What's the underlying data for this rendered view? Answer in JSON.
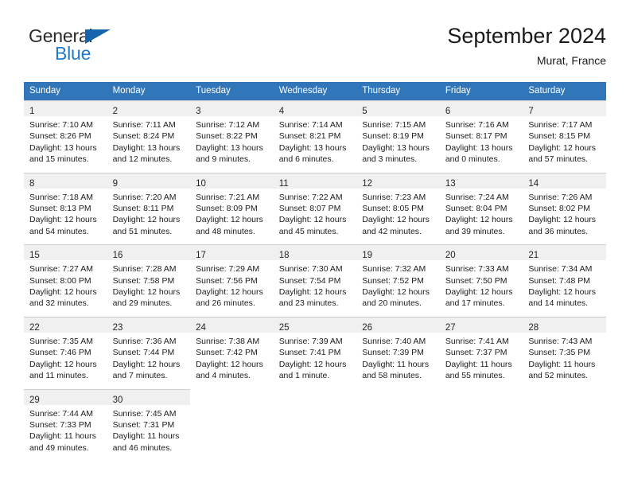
{
  "brand": {
    "line1": "General",
    "line2": "Blue",
    "triangle_color": "#1565ad",
    "line2_color": "#2079c6"
  },
  "header": {
    "title": "September 2024",
    "location": "Murat, France"
  },
  "theme": {
    "header_blue": "#3076b8",
    "daynum_band": "#f0f0f0",
    "grid_line": "#cfcfcf"
  },
  "calendar": {
    "weekday_headers": [
      "Sunday",
      "Monday",
      "Tuesday",
      "Wednesday",
      "Thursday",
      "Friday",
      "Saturday"
    ],
    "weeks": [
      [
        {
          "day": "1",
          "sunrise": "Sunrise: 7:10 AM",
          "sunset": "Sunset: 8:26 PM",
          "daylight1": "Daylight: 13 hours",
          "daylight2": "and 15 minutes."
        },
        {
          "day": "2",
          "sunrise": "Sunrise: 7:11 AM",
          "sunset": "Sunset: 8:24 PM",
          "daylight1": "Daylight: 13 hours",
          "daylight2": "and 12 minutes."
        },
        {
          "day": "3",
          "sunrise": "Sunrise: 7:12 AM",
          "sunset": "Sunset: 8:22 PM",
          "daylight1": "Daylight: 13 hours",
          "daylight2": "and 9 minutes."
        },
        {
          "day": "4",
          "sunrise": "Sunrise: 7:14 AM",
          "sunset": "Sunset: 8:21 PM",
          "daylight1": "Daylight: 13 hours",
          "daylight2": "and 6 minutes."
        },
        {
          "day": "5",
          "sunrise": "Sunrise: 7:15 AM",
          "sunset": "Sunset: 8:19 PM",
          "daylight1": "Daylight: 13 hours",
          "daylight2": "and 3 minutes."
        },
        {
          "day": "6",
          "sunrise": "Sunrise: 7:16 AM",
          "sunset": "Sunset: 8:17 PM",
          "daylight1": "Daylight: 13 hours",
          "daylight2": "and 0 minutes."
        },
        {
          "day": "7",
          "sunrise": "Sunrise: 7:17 AM",
          "sunset": "Sunset: 8:15 PM",
          "daylight1": "Daylight: 12 hours",
          "daylight2": "and 57 minutes."
        }
      ],
      [
        {
          "day": "8",
          "sunrise": "Sunrise: 7:18 AM",
          "sunset": "Sunset: 8:13 PM",
          "daylight1": "Daylight: 12 hours",
          "daylight2": "and 54 minutes."
        },
        {
          "day": "9",
          "sunrise": "Sunrise: 7:20 AM",
          "sunset": "Sunset: 8:11 PM",
          "daylight1": "Daylight: 12 hours",
          "daylight2": "and 51 minutes."
        },
        {
          "day": "10",
          "sunrise": "Sunrise: 7:21 AM",
          "sunset": "Sunset: 8:09 PM",
          "daylight1": "Daylight: 12 hours",
          "daylight2": "and 48 minutes."
        },
        {
          "day": "11",
          "sunrise": "Sunrise: 7:22 AM",
          "sunset": "Sunset: 8:07 PM",
          "daylight1": "Daylight: 12 hours",
          "daylight2": "and 45 minutes."
        },
        {
          "day": "12",
          "sunrise": "Sunrise: 7:23 AM",
          "sunset": "Sunset: 8:05 PM",
          "daylight1": "Daylight: 12 hours",
          "daylight2": "and 42 minutes."
        },
        {
          "day": "13",
          "sunrise": "Sunrise: 7:24 AM",
          "sunset": "Sunset: 8:04 PM",
          "daylight1": "Daylight: 12 hours",
          "daylight2": "and 39 minutes."
        },
        {
          "day": "14",
          "sunrise": "Sunrise: 7:26 AM",
          "sunset": "Sunset: 8:02 PM",
          "daylight1": "Daylight: 12 hours",
          "daylight2": "and 36 minutes."
        }
      ],
      [
        {
          "day": "15",
          "sunrise": "Sunrise: 7:27 AM",
          "sunset": "Sunset: 8:00 PM",
          "daylight1": "Daylight: 12 hours",
          "daylight2": "and 32 minutes."
        },
        {
          "day": "16",
          "sunrise": "Sunrise: 7:28 AM",
          "sunset": "Sunset: 7:58 PM",
          "daylight1": "Daylight: 12 hours",
          "daylight2": "and 29 minutes."
        },
        {
          "day": "17",
          "sunrise": "Sunrise: 7:29 AM",
          "sunset": "Sunset: 7:56 PM",
          "daylight1": "Daylight: 12 hours",
          "daylight2": "and 26 minutes."
        },
        {
          "day": "18",
          "sunrise": "Sunrise: 7:30 AM",
          "sunset": "Sunset: 7:54 PM",
          "daylight1": "Daylight: 12 hours",
          "daylight2": "and 23 minutes."
        },
        {
          "day": "19",
          "sunrise": "Sunrise: 7:32 AM",
          "sunset": "Sunset: 7:52 PM",
          "daylight1": "Daylight: 12 hours",
          "daylight2": "and 20 minutes."
        },
        {
          "day": "20",
          "sunrise": "Sunrise: 7:33 AM",
          "sunset": "Sunset: 7:50 PM",
          "daylight1": "Daylight: 12 hours",
          "daylight2": "and 17 minutes."
        },
        {
          "day": "21",
          "sunrise": "Sunrise: 7:34 AM",
          "sunset": "Sunset: 7:48 PM",
          "daylight1": "Daylight: 12 hours",
          "daylight2": "and 14 minutes."
        }
      ],
      [
        {
          "day": "22",
          "sunrise": "Sunrise: 7:35 AM",
          "sunset": "Sunset: 7:46 PM",
          "daylight1": "Daylight: 12 hours",
          "daylight2": "and 11 minutes."
        },
        {
          "day": "23",
          "sunrise": "Sunrise: 7:36 AM",
          "sunset": "Sunset: 7:44 PM",
          "daylight1": "Daylight: 12 hours",
          "daylight2": "and 7 minutes."
        },
        {
          "day": "24",
          "sunrise": "Sunrise: 7:38 AM",
          "sunset": "Sunset: 7:42 PM",
          "daylight1": "Daylight: 12 hours",
          "daylight2": "and 4 minutes."
        },
        {
          "day": "25",
          "sunrise": "Sunrise: 7:39 AM",
          "sunset": "Sunset: 7:41 PM",
          "daylight1": "Daylight: 12 hours",
          "daylight2": "and 1 minute."
        },
        {
          "day": "26",
          "sunrise": "Sunrise: 7:40 AM",
          "sunset": "Sunset: 7:39 PM",
          "daylight1": "Daylight: 11 hours",
          "daylight2": "and 58 minutes."
        },
        {
          "day": "27",
          "sunrise": "Sunrise: 7:41 AM",
          "sunset": "Sunset: 7:37 PM",
          "daylight1": "Daylight: 11 hours",
          "daylight2": "and 55 minutes."
        },
        {
          "day": "28",
          "sunrise": "Sunrise: 7:43 AM",
          "sunset": "Sunset: 7:35 PM",
          "daylight1": "Daylight: 11 hours",
          "daylight2": "and 52 minutes."
        }
      ],
      [
        {
          "day": "29",
          "sunrise": "Sunrise: 7:44 AM",
          "sunset": "Sunset: 7:33 PM",
          "daylight1": "Daylight: 11 hours",
          "daylight2": "and 49 minutes."
        },
        {
          "day": "30",
          "sunrise": "Sunrise: 7:45 AM",
          "sunset": "Sunset: 7:31 PM",
          "daylight1": "Daylight: 11 hours",
          "daylight2": "and 46 minutes."
        },
        {
          "day": "",
          "sunrise": "",
          "sunset": "",
          "daylight1": "",
          "daylight2": ""
        },
        {
          "day": "",
          "sunrise": "",
          "sunset": "",
          "daylight1": "",
          "daylight2": ""
        },
        {
          "day": "",
          "sunrise": "",
          "sunset": "",
          "daylight1": "",
          "daylight2": ""
        },
        {
          "day": "",
          "sunrise": "",
          "sunset": "",
          "daylight1": "",
          "daylight2": ""
        },
        {
          "day": "",
          "sunrise": "",
          "sunset": "",
          "daylight1": "",
          "daylight2": ""
        }
      ]
    ]
  }
}
